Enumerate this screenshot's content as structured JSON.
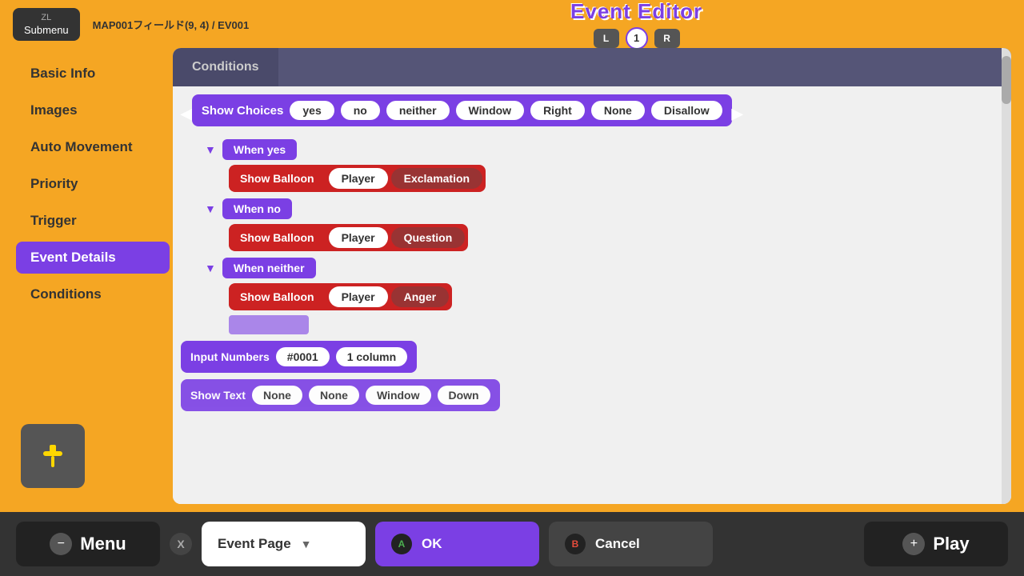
{
  "topBar": {
    "zl": "ZL",
    "submenu": "Submenu",
    "breadcrumb": "MAP001フィールド(9, 4) / EV001",
    "title": "Event Editor",
    "pageL": "L",
    "pageNum": "1",
    "pageR": "R"
  },
  "sidebar": {
    "items": [
      {
        "id": "basic-info",
        "label": "Basic Info",
        "active": false
      },
      {
        "id": "images",
        "label": "Images",
        "active": false
      },
      {
        "id": "auto-movement",
        "label": "Auto Movement",
        "active": false
      },
      {
        "id": "priority",
        "label": "Priority",
        "active": false
      },
      {
        "id": "trigger",
        "label": "Trigger",
        "active": false
      },
      {
        "id": "event-details",
        "label": "Event Details",
        "active": true
      },
      {
        "id": "conditions",
        "label": "Conditions",
        "active": false
      }
    ],
    "addBtn": "+"
  },
  "tabs": {
    "conditions": "Conditions"
  },
  "showChoices": {
    "label": "Show Choices",
    "options": [
      "yes",
      "no",
      "neither",
      "Window",
      "Right",
      "None",
      "Disallow"
    ]
  },
  "whenBlocks": [
    {
      "label": "When yes",
      "action": "Show Balloon",
      "target": "Player",
      "type": "Exclamation"
    },
    {
      "label": "When no",
      "action": "Show Balloon",
      "target": "Player",
      "type": "Question"
    },
    {
      "label": "When neither",
      "action": "Show Balloon",
      "target": "Player",
      "type": "Anger"
    }
  ],
  "inputNumbers": {
    "label": "Input Numbers",
    "id": "#0001",
    "columns": "1 column"
  },
  "showText": {
    "label": "Show Text",
    "options": [
      "None",
      "None",
      "Window",
      "Down"
    ]
  },
  "bottomBar": {
    "menuMinus": "−",
    "menuLabel": "Menu",
    "xLabel": "X",
    "eventPageLabel": "Event Page",
    "aLabel": "A",
    "okLabel": "OK",
    "bLabel": "B",
    "cancelLabel": "Cancel",
    "playPlus": "+",
    "playLabel": "Play"
  }
}
